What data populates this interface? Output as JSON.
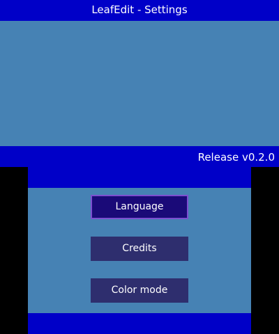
{
  "header": {
    "title": "LeafEdit - Settings"
  },
  "footer": {
    "version": "Release v0.2.0"
  },
  "menu": {
    "items": [
      {
        "label": "Language",
        "selected": true
      },
      {
        "label": "Credits",
        "selected": false
      },
      {
        "label": "Color mode",
        "selected": false
      }
    ]
  },
  "colors": {
    "bar_blue": "#0000c8",
    "background_steel_blue": "#4682b4",
    "button_navy": "#2e2e6e",
    "button_selected": "#1a0a78",
    "button_selected_border": "#7c4fd0",
    "side_black": "#000000"
  }
}
